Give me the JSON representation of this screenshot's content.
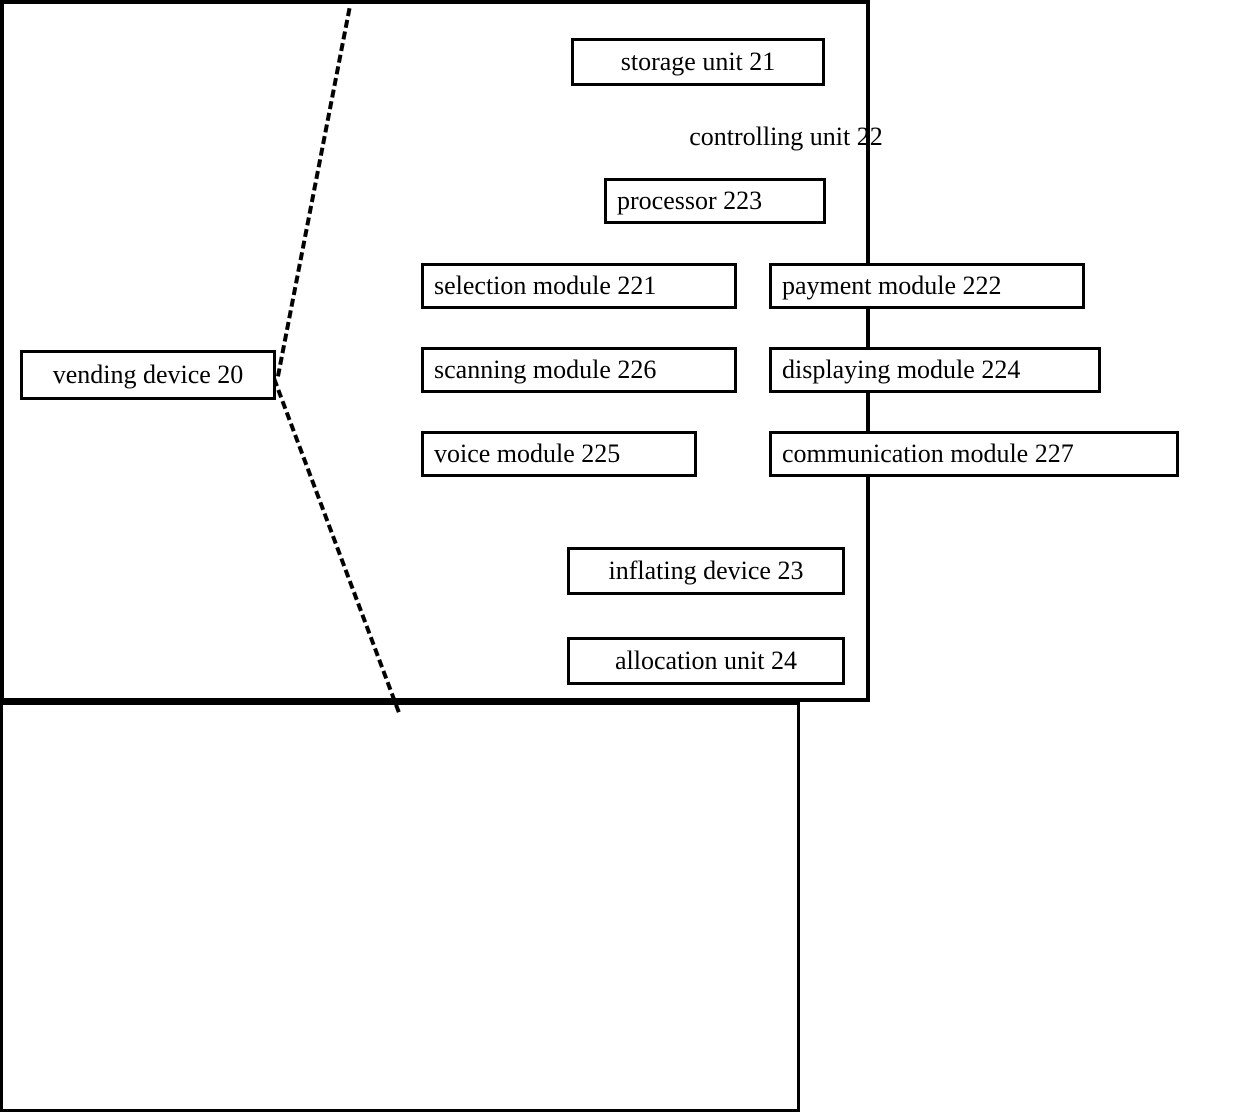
{
  "vending_device": "vending device 20",
  "main": {
    "storage_unit": "storage unit 21",
    "controlling_unit": {
      "title": "controlling unit 22",
      "processor": "processor 223",
      "selection_module": "selection module 221",
      "payment_module": "payment module 222",
      "scanning_module": "scanning module 226",
      "displaying_module": "displaying module 224",
      "voice_module": "voice module 225",
      "communication_module": "communication module 227"
    },
    "inflating_device": "inflating device 23",
    "allocation_unit": "allocation unit 24"
  }
}
